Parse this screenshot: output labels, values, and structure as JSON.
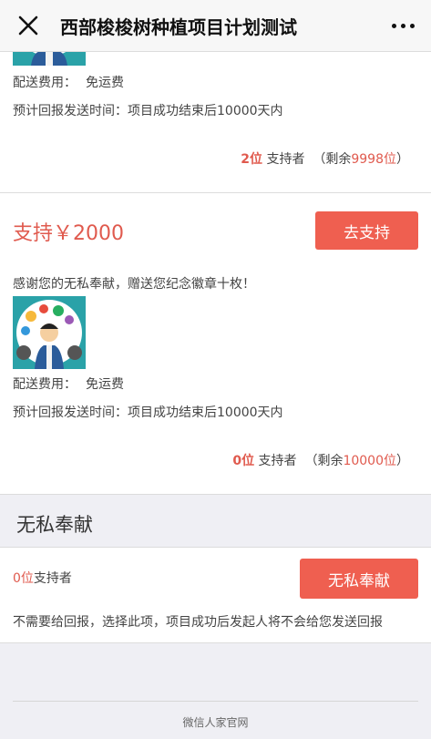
{
  "nav": {
    "title": "西部梭梭树种植项目计划测试"
  },
  "reward_top": {
    "shipping_label": "配送费用：",
    "shipping_value": "免运费",
    "delivery_label": "预计回报发送时间：",
    "delivery_value": "项目成功结束后10000天内",
    "backers_count": "2位",
    "backers_text": "支持者",
    "remaining_prefix": "（剩余",
    "remaining_count": "9998位",
    "remaining_suffix": "）"
  },
  "reward_2000": {
    "price": "支持￥2000",
    "button": "去支持",
    "description": "感谢您的无私奉献，赠送您纪念徽章十枚！",
    "shipping_label": "配送费用：",
    "shipping_value": "免运费",
    "delivery_label": "预计回报发送时间：",
    "delivery_value": "项目成功结束后10000天内",
    "backers_count": "0位",
    "backers_text": "支持者",
    "remaining_prefix": "（剩余",
    "remaining_count": "10000位",
    "remaining_suffix": "）"
  },
  "selfless": {
    "section_title": "无私奉献",
    "backers_count": "0位",
    "backers_text": "支持者",
    "button": "无私奉献",
    "note": "不需要给回报，选择此项，项目成功后发起人将不会给您发送回报"
  },
  "footer": {
    "text": "微信人家官网"
  },
  "colors": {
    "accent": "#ef5f50",
    "accent_text": "#e05a4e",
    "background": "#efeff4",
    "thumb_bg": "#2aa2a8"
  },
  "icons": [
    "close-icon",
    "more-icon"
  ]
}
